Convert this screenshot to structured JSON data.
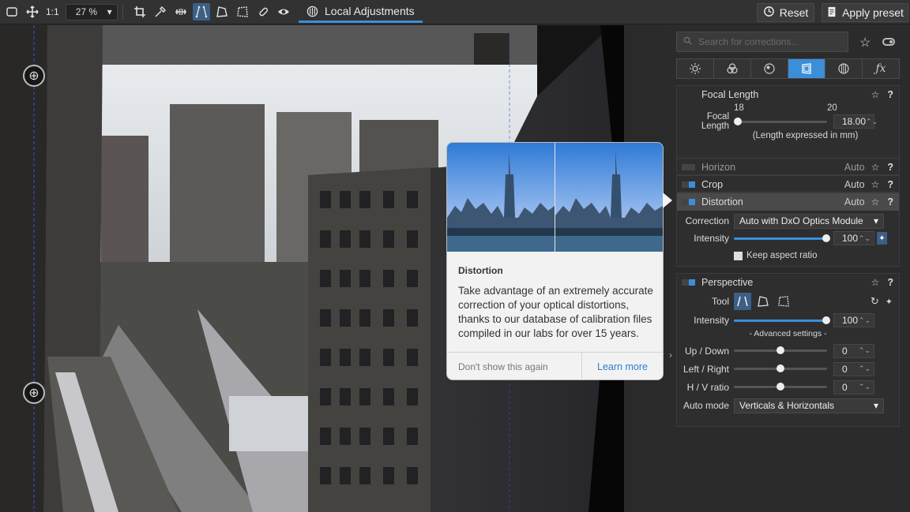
{
  "toolbar": {
    "fit_label": "1:1",
    "zoom_value": "27 %",
    "local_adjustments_label": "Local Adjustments",
    "reset_label": "Reset",
    "apply_preset_label": "Apply preset"
  },
  "panel": {
    "search_placeholder": "Search for corrections...",
    "tabs": [
      "light",
      "color",
      "detail",
      "geometry",
      "watermark",
      "fx"
    ],
    "focal": {
      "title": "Focal Length",
      "scale_min": "18",
      "scale_max": "20",
      "label": "Focal Length",
      "value": "18.00",
      "note": "(Length expressed in mm)"
    },
    "horizon": {
      "title": "Horizon",
      "auto": "Auto"
    },
    "crop": {
      "title": "Crop",
      "auto": "Auto"
    },
    "distortion": {
      "title": "Distortion",
      "auto": "Auto",
      "correction_label": "Correction",
      "correction_value": "Auto with DxO Optics Module",
      "intensity_label": "Intensity",
      "intensity_value": "100",
      "intensity_fraction": 1.0,
      "keep_aspect_label": "Keep aspect ratio"
    },
    "perspective": {
      "title": "Perspective",
      "tool_label": "Tool",
      "intensity_label": "Intensity",
      "intensity_value": "100",
      "advanced_label": "- Advanced settings -",
      "updown_label": "Up / Down",
      "updown_value": "0",
      "leftright_label": "Left / Right",
      "leftright_value": "0",
      "hv_label": "H / V ratio",
      "hv_value": "0",
      "automode_label": "Auto mode",
      "automode_value": "Verticals & Horizontals"
    }
  },
  "popup": {
    "title": "Distortion",
    "body": "Take advantage of an extremely accurate correction of your optical distortions, thanks to our database of calibration files compiled in our labs for over 15 years.",
    "dont_show": "Don't show this again",
    "learn_more": "Learn more"
  },
  "colors": {
    "accent": "#3b8fd9",
    "panel_bg": "#2b2b2b",
    "toolbar_bg": "#323232"
  }
}
